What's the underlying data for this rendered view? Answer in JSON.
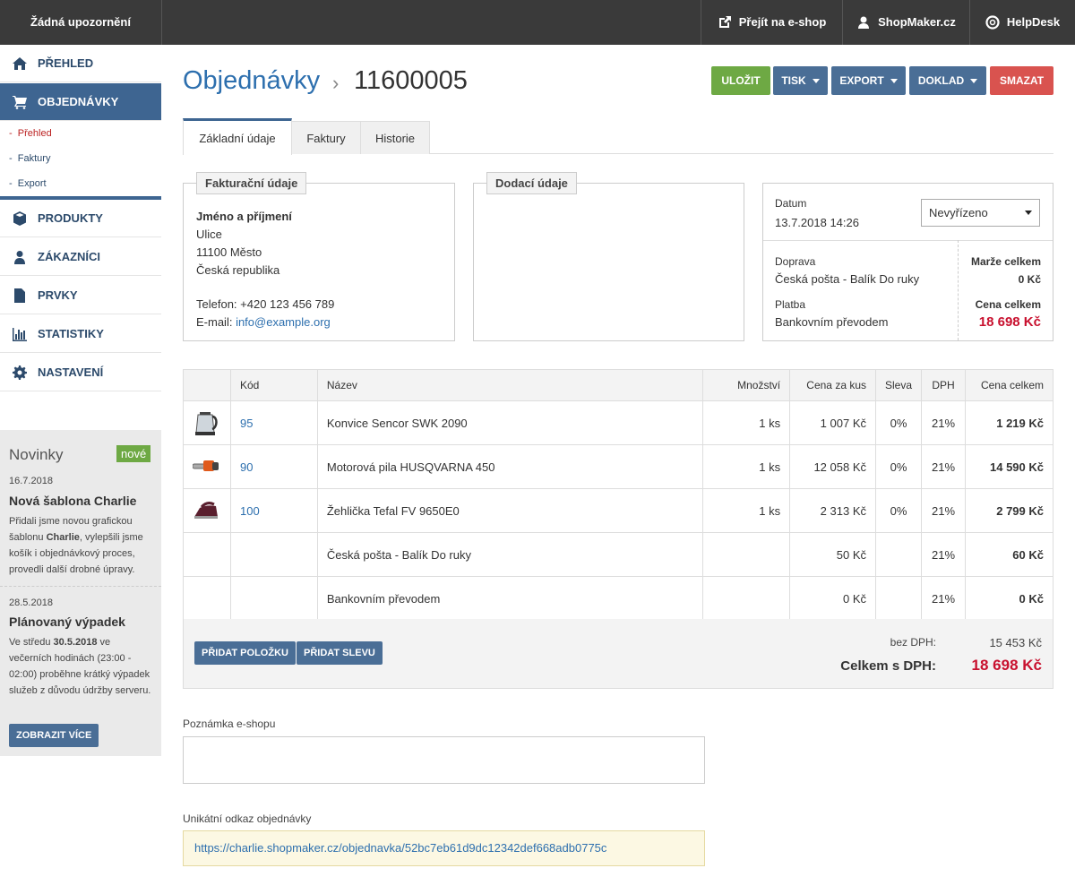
{
  "topbar": {
    "notifications": "Žádná upozornění",
    "eshop_link": "Přejít na e-shop",
    "account_link": "ShopMaker.cz",
    "help_link": "HelpDesk"
  },
  "sidebar": {
    "items": [
      {
        "label": "PŘEHLED",
        "icon": "home-icon"
      },
      {
        "label": "OBJEDNÁVKY",
        "icon": "cart-icon"
      },
      {
        "label": "PRODUKTY",
        "icon": "box-icon"
      },
      {
        "label": "ZÁKAZNÍCI",
        "icon": "user-icon"
      },
      {
        "label": "PRVKY",
        "icon": "file-icon"
      },
      {
        "label": "STATISTIKY",
        "icon": "bar-chart-icon"
      },
      {
        "label": "NASTAVENÍ",
        "icon": "gear-icon"
      }
    ],
    "sub_items": [
      "Přehled",
      "Faktury",
      "Export"
    ]
  },
  "news": {
    "heading": "Novinky",
    "badge": "nové",
    "items": [
      {
        "date": "16.7.2018",
        "title": "Nová šablona Charlie",
        "text_a": "Přidali jsme novou grafickou šablonu ",
        "text_bold": "Charlie",
        "text_b": ", vylepšili jsme košík i objednávkový proces, provedli další drobné úpravy."
      },
      {
        "date": "28.5.2018",
        "title": "Plánovaný výpadek",
        "text_a": "Ve středu ",
        "text_bold": "30.5.2018",
        "text_b": " ve večerních hodinách (23:00 - 02:00) proběhne krátký výpadek služeb z důvodu údržby serveru."
      }
    ],
    "more_button": "ZOBRAZIT VÍCE"
  },
  "header": {
    "breadcrumb_root": "Objednávky",
    "order_number": "11600005"
  },
  "toolbar": {
    "save": "ULOŽIT",
    "print": "TISK",
    "export": "EXPORT",
    "document": "DOKLAD",
    "delete": "SMAZAT"
  },
  "tabs": [
    "Základní údaje",
    "Faktury",
    "Historie"
  ],
  "billing": {
    "legend": "Fakturační údaje",
    "name": "Jméno a příjmení",
    "street": "Ulice",
    "city": "11100 Město",
    "country": "Česká republika",
    "phone": "Telefon: +420 123 456 789",
    "email_label": "E-mail: ",
    "email": "info@example.org"
  },
  "delivery": {
    "legend": "Dodací údaje"
  },
  "order_info": {
    "date_label": "Datum",
    "date": "13.7.2018 14:26",
    "status": "Nevyřízeno",
    "shipping_label": "Doprava",
    "shipping": "Česká pošta - Balík Do ruky",
    "payment_label": "Platba",
    "payment": "Bankovním převodem",
    "margin_label": "Marže celkem",
    "margin": "0 Kč",
    "total_label": "Cena celkem",
    "total": "18 698 Kč"
  },
  "table": {
    "headers": {
      "code": "Kód",
      "name": "Název",
      "qty": "Množství",
      "unit_price": "Cena za kus",
      "discount": "Sleva",
      "vat": "DPH",
      "total": "Cena celkem"
    },
    "rows": [
      {
        "code": "95",
        "name": "Konvice Sencor SWK 2090",
        "qty": "1 ks",
        "unit_price": "1 007 Kč",
        "discount": "0%",
        "vat": "21%",
        "total": "1 219 Kč",
        "image": "kettle-image"
      },
      {
        "code": "90",
        "name": "Motorová pila HUSQVARNA 450",
        "qty": "1 ks",
        "unit_price": "12 058 Kč",
        "discount": "0%",
        "vat": "21%",
        "total": "14 590 Kč",
        "image": "chainsaw-image"
      },
      {
        "code": "100",
        "name": "Žehlička Tefal FV 9650E0",
        "qty": "1 ks",
        "unit_price": "2 313 Kč",
        "discount": "0%",
        "vat": "21%",
        "total": "2 799 Kč",
        "image": "iron-image"
      },
      {
        "code": "",
        "name": "Česká pošta - Balík Do ruky",
        "qty": "",
        "unit_price": "50 Kč",
        "discount": "",
        "vat": "21%",
        "total": "60 Kč",
        "image": ""
      },
      {
        "code": "",
        "name": "Bankovním převodem",
        "qty": "",
        "unit_price": "0 Kč",
        "discount": "",
        "vat": "21%",
        "total": "0 Kč",
        "image": ""
      }
    ]
  },
  "summary": {
    "add_item": "PŘIDAT POLOŽKU",
    "add_discount": "PŘIDAT SLEVU",
    "net_label": "bez DPH:",
    "net": "15 453 Kč",
    "gross_label": "Celkem s DPH:",
    "gross": "18 698 Kč"
  },
  "note": {
    "label": "Poznámka e-shopu",
    "value": ""
  },
  "unique_link": {
    "label": "Unikátní odkaz objednávky",
    "url": "https://charlie.shopmaker.cz/objednavka/52bc7eb61d9dc12342def668adb0775c"
  },
  "colors": {
    "topbar": "#3a3a3a",
    "accent": "#3e6591",
    "save": "#6ea944",
    "delete": "#d9534f",
    "price": "#c8102e"
  }
}
